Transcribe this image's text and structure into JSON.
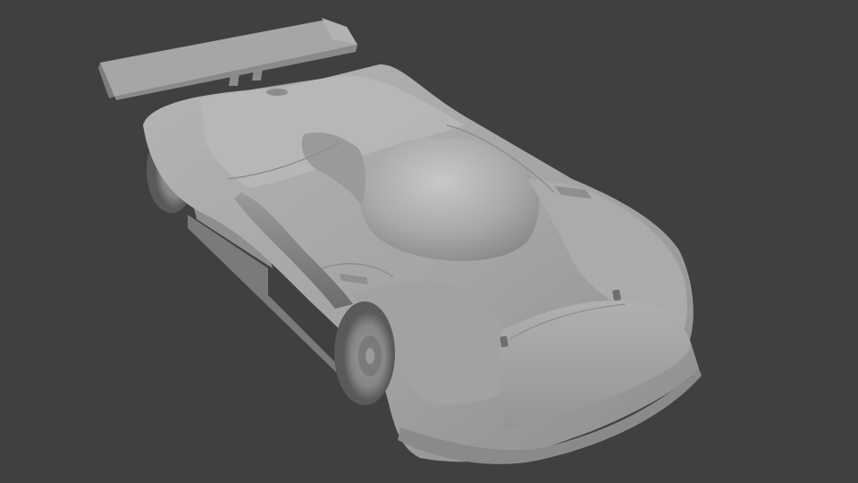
{
  "scene": {
    "background_color": "#404040",
    "subject": "car-render",
    "material_base_color": "#a8a8a8",
    "material_shadow_color": "#6a6a6a",
    "material_highlight_color": "#c6c6c6",
    "icons": [
      "car-body",
      "rear-wing",
      "front-wheel",
      "rear-wheel",
      "canopy"
    ]
  }
}
